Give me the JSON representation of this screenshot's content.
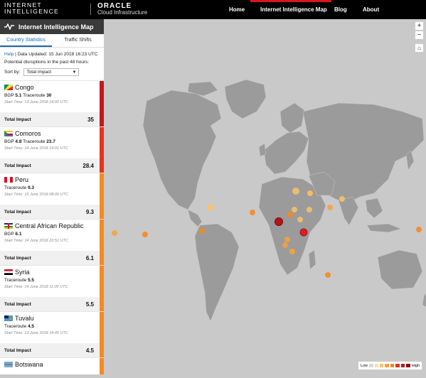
{
  "header": {
    "brand_line1": "INTERNET",
    "brand_line2": "INTELLIGENCE",
    "oracle": "ORACLE",
    "oracle_sub": "Cloud Infrastructure",
    "nav": [
      "Home",
      "Internet Intelligence Map",
      "Blog",
      "About"
    ],
    "active_nav": "Internet Intelligence Map"
  },
  "sidebar": {
    "title": "Internet Intelligence Map",
    "tabs": [
      "Country Statistics",
      "Traffic Shifts"
    ],
    "help": "Help",
    "data_updated": "Data Updated: 15 Jun 2018 16:23 UTC",
    "disruptions_note": "Potential disruptions in the past 48 hours:",
    "sort_label": "Sort by:",
    "sort_value": "Total impact",
    "cards": [
      {
        "country": "Congo",
        "bgp_label": "BGP",
        "bgp": "5.1",
        "tr_label": "Traceroute",
        "traceroute": "30",
        "start_time": "Start Time: 13 June 2018 14:00 UTC",
        "impact_label": "Total Impact",
        "impact": "35",
        "color": "#c4161d"
      },
      {
        "country": "Comoros",
        "bgp_label": "BGP",
        "bgp": "4.8",
        "tr_label": "Traceroute",
        "traceroute": "23.7",
        "start_time": "Start Time: 14 June 2018 14:01 UTC",
        "impact_label": "Total Impact",
        "impact": "28.4",
        "color": "#e8321c"
      },
      {
        "country": "Peru",
        "bgp_label": "",
        "bgp": "",
        "tr_label": "Traceroute",
        "traceroute": "9.3",
        "start_time": "Start Time: 15 June 2018 08:00 UTC",
        "impact_label": "Total Impact",
        "impact": "9.3",
        "color": "#f68a1f"
      },
      {
        "country": "Central African Republic",
        "bgp_label": "BGP",
        "bgp": "6.1",
        "tr_label": "",
        "traceroute": "",
        "start_time": "Start Time: 14 June 2018 22:51 UTC",
        "impact_label": "Total Impact",
        "impact": "6.1",
        "color": "#f68a1f"
      },
      {
        "country": "Syria",
        "bgp_label": "",
        "bgp": "",
        "tr_label": "Traceroute",
        "traceroute": "5.5",
        "start_time": "Start Time: 14 June 2018 11:00 UTC",
        "impact_label": "Total Impact",
        "impact": "5.5",
        "color": "#f68a1f"
      },
      {
        "country": "Tuvalu",
        "bgp_label": "",
        "bgp": "",
        "tr_label": "Traceroute",
        "traceroute": "4.5",
        "start_time": "Start Time: 13 June 2018 14:45 UTC",
        "impact_label": "Total Impact",
        "impact": "4.5",
        "color": "#f68a1f"
      },
      {
        "country": "Botswana",
        "bgp_label": "",
        "bgp": "",
        "tr_label": "",
        "traceroute": "",
        "start_time": "",
        "impact_label": "",
        "impact": "",
        "color": "#f68a1f"
      }
    ]
  },
  "map_controls": {
    "zoom_in": "+",
    "zoom_out": "−",
    "home": "⌂"
  },
  "legend": {
    "low": "Low",
    "high": "High",
    "colors": [
      "#d8d8d8",
      "#f9e0b0",
      "#f8c36a",
      "#f6a23a",
      "#f68a1f",
      "#e8321c",
      "#c4161d",
      "#8e0d12"
    ]
  },
  "markers": [
    {
      "name": "Congo",
      "color": "#b5121b"
    },
    {
      "name": "Comoros",
      "color": "#e01b22"
    },
    {
      "name": "Peru",
      "color": "#f68a1f"
    },
    {
      "name": "Central African Republic",
      "color": "#f68a1f"
    },
    {
      "name": "Syria",
      "color": "#f68a1f"
    },
    {
      "name": "Tuvalu",
      "color": "#f68a1f"
    },
    {
      "name": "Botswana",
      "color": "#f6a23a"
    }
  ]
}
